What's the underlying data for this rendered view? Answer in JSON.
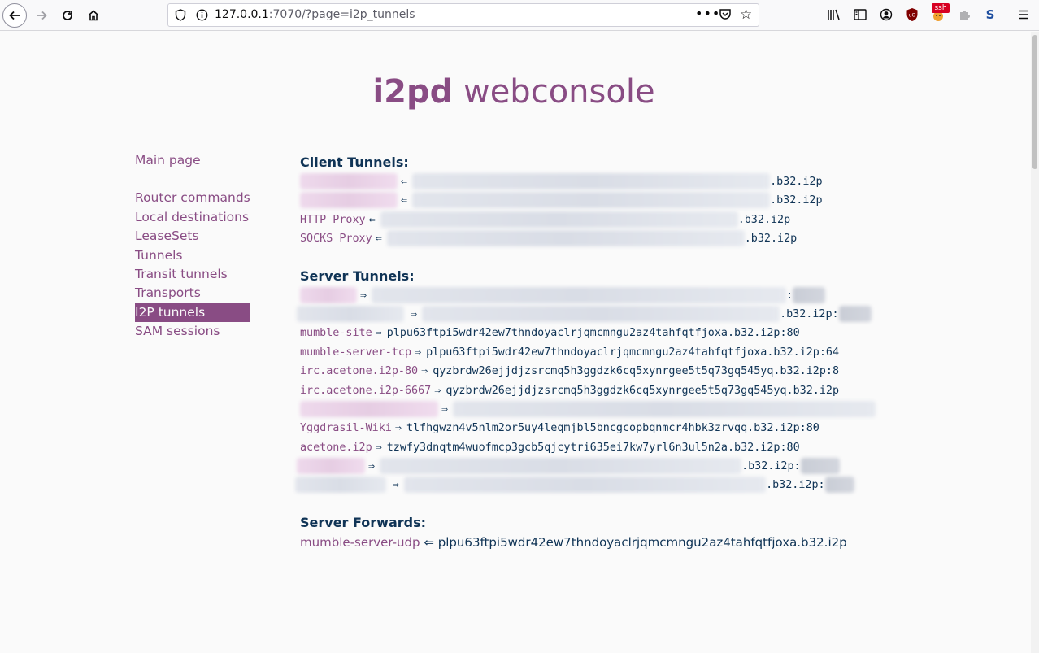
{
  "browser": {
    "url_host": "127.0.0.1",
    "url_rest": ":7070/?page=i2p_tunnels",
    "ext_badge": "ssh",
    "ext_s": "S"
  },
  "header": {
    "bold": "i2pd",
    "rest": " webconsole"
  },
  "menu": [
    {
      "label": "Main page"
    },
    {
      "label": "Router commands"
    },
    {
      "label": "Local destinations"
    },
    {
      "label": "LeaseSets"
    },
    {
      "label": "Tunnels"
    },
    {
      "label": "Transit tunnels"
    },
    {
      "label": "Transports"
    },
    {
      "label": "I2P tunnels"
    },
    {
      "label": "SAM sessions"
    }
  ],
  "client_tunnels": {
    "title": "Client Tunnels:",
    "suffix": ".b32.i2p",
    "http_name": "HTTP Proxy",
    "socks_name": "SOCKS Proxy",
    "arrow": "⇐"
  },
  "server_tunnels": {
    "title": "Server Tunnels:",
    "arrow": "⇒",
    "suffix": ".b32.i2p:",
    "items": [
      {
        "name": "mumble-site",
        "dest": "plpu63ftpi5wdr42ew7thndoyaclrjqmcmngu2az4tahfqtfjoxa.b32.i2p:80"
      },
      {
        "name": "mumble-server-tcp",
        "dest": "plpu63ftpi5wdr42ew7thndoyaclrjqmcmngu2az4tahfqtfjoxa.b32.i2p:64"
      },
      {
        "name": "irc.acetone.i2p-80",
        "dest": "qyzbrdw26ejjdjzsrcmq5h3ggdzk6cq5xynrgee5t5q73gq545yq.b32.i2p:8"
      },
      {
        "name": "irc.acetone.i2p-6667",
        "dest": "qyzbrdw26ejjdjzsrcmq5h3ggdzk6cq5xynrgee5t5q73gq545yq.b32.i2p"
      },
      {
        "name": "Yggdrasil-Wiki",
        "dest": "tlfhgwzn4v5nlm2or5uy4leqmjbl5bncgcopbqnmcr4hbk3zrvqq.b32.i2p:80"
      },
      {
        "name": "acetone.i2p",
        "dest": "tzwfy3dnqtm4wuofmcp3gcb5qjcytri635ei7kw7yrl6n3ul5n2a.b32.i2p:80"
      }
    ]
  },
  "server_forwards": {
    "title": "Server Forwards:",
    "name": "mumble-server-udp",
    "arrow": "⇐",
    "dest": "plpu63ftpi5wdr42ew7thndoyaclrjqmcmngu2az4tahfqtfjoxa.b32.i2p"
  }
}
